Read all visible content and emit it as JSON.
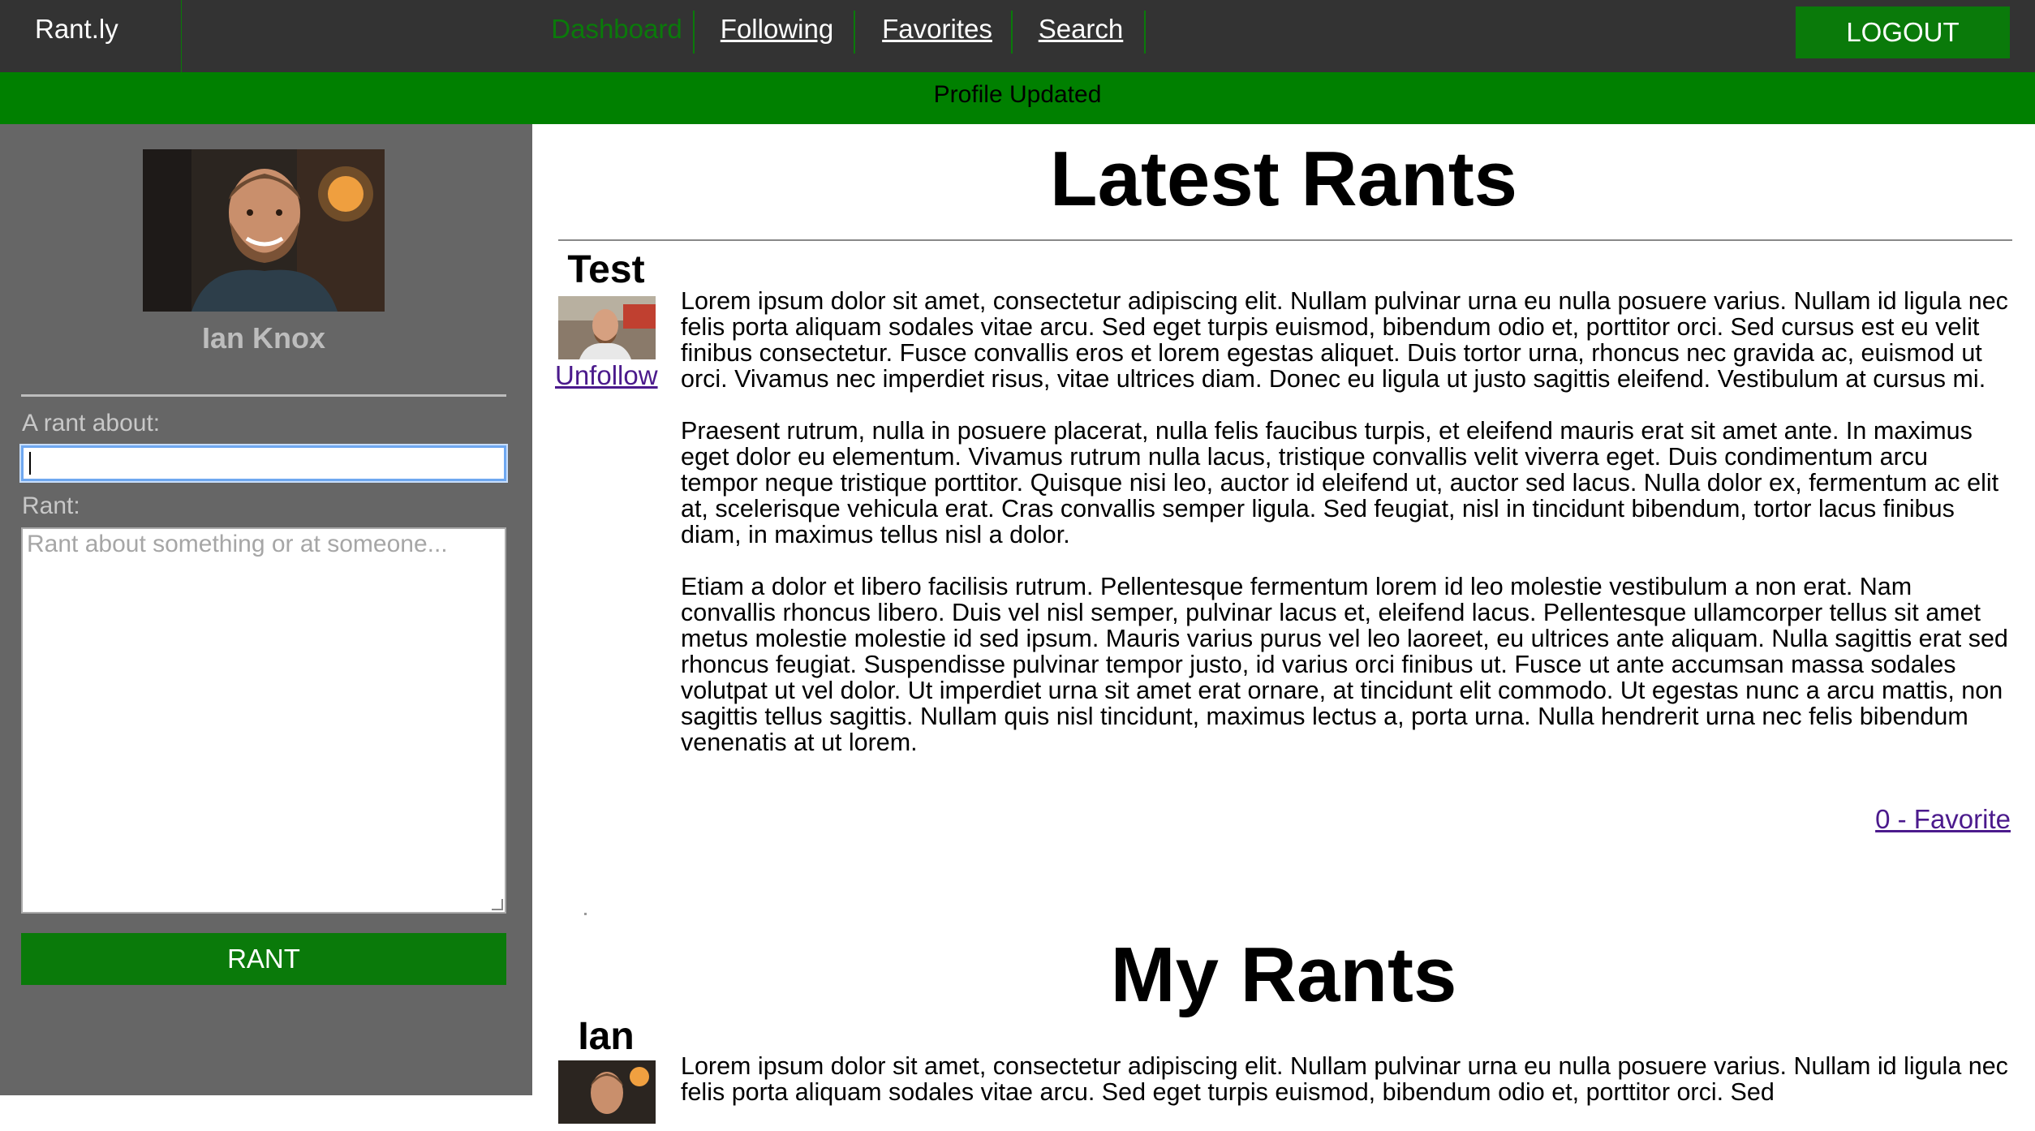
{
  "header": {
    "brand": "Rant.ly",
    "nav": [
      {
        "label": "Dashboard",
        "active": true
      },
      {
        "label": "Following",
        "active": false
      },
      {
        "label": "Favorites",
        "active": false
      },
      {
        "label": "Search",
        "active": false
      }
    ],
    "logout_label": "LOGOUT"
  },
  "flash": {
    "message": "Profile Updated"
  },
  "sidebar": {
    "user_name": "Ian Knox",
    "rant_about_label": "A rant about:",
    "rant_about_value": "",
    "rant_label": "Rant:",
    "rant_placeholder": "Rant about something or at someone...",
    "submit_label": "RANT"
  },
  "latest": {
    "title": "Latest Rants",
    "items": [
      {
        "author": "Test",
        "follow_action": "Unfollow",
        "paragraphs": [
          "Lorem ipsum dolor sit amet, consectetur adipiscing elit. Nullam pulvinar urna eu nulla posuere varius. Nullam id ligula nec felis porta aliquam sodales vitae arcu. Sed eget turpis euismod, bibendum odio et, porttitor orci. Sed cursus est eu velit finibus consectetur. Fusce convallis eros et lorem egestas aliquet. Duis tortor urna, rhoncus nec gravida ac, euismod ut orci. Vivamus nec imperdiet risus, vitae ultrices diam. Donec eu ligula ut justo sagittis eleifend. Vestibulum at cursus mi.",
          "Praesent rutrum, nulla in posuere placerat, nulla felis faucibus turpis, et eleifend mauris erat sit amet ante. In maximus eget dolor eu elementum. Vivamus rutrum nulla lacus, tristique convallis velit viverra eget. Duis condimentum arcu tempor neque tristique porttitor. Quisque nisi leo, auctor id eleifend ut, auctor sed lacus. Nulla dolor ex, fermentum ac elit at, scelerisque vehicula erat. Cras convallis semper ligula. Sed feugiat, nisl in tincidunt bibendum, tortor lacus finibus diam, in maximus tellus nisl a dolor.",
          "Etiam a dolor et libero facilisis rutrum. Pellentesque fermentum lorem id leo molestie vestibulum a non erat. Nam convallis rhoncus libero. Duis vel nisl semper, pulvinar lacus et, eleifend lacus. Pellentesque ullamcorper tellus sit amet metus molestie molestie id sed ipsum. Mauris varius purus vel leo laoreet, eu ultrices ante aliquam. Nulla sagittis erat sed rhoncus feugiat. Suspendisse pulvinar tempor justo, id varius orci finibus ut. Fusce ut ante accumsan massa sodales volutpat ut vel dolor. Ut imperdiet urna sit amet erat ornare, at tincidunt elit commodo. Ut egestas nunc a arcu mattis, non sagittis tellus sagittis. Nullam quis nisl tincidunt, maximus lectus a, porta urna. Nulla hendrerit urna nec felis bibendum venenatis at ut lorem."
        ],
        "favorite_label": "0 - Favorite"
      }
    ]
  },
  "mine": {
    "title": "My Rants",
    "items": [
      {
        "author": "Ian",
        "paragraphs": [
          "Lorem ipsum dolor sit amet, consectetur adipiscing elit. Nullam pulvinar urna eu nulla posuere varius. Nullam id ligula nec felis porta aliquam sodales vitae arcu. Sed eget turpis euismod, bibendum odio et, porttitor orci. Sed"
        ]
      }
    ]
  },
  "colors": {
    "nav_bg": "#333333",
    "accent_green": "#0a7a0a",
    "flash_green": "#008000",
    "sidebar_bg": "#666666",
    "visited_link": "#4b1a8c"
  }
}
